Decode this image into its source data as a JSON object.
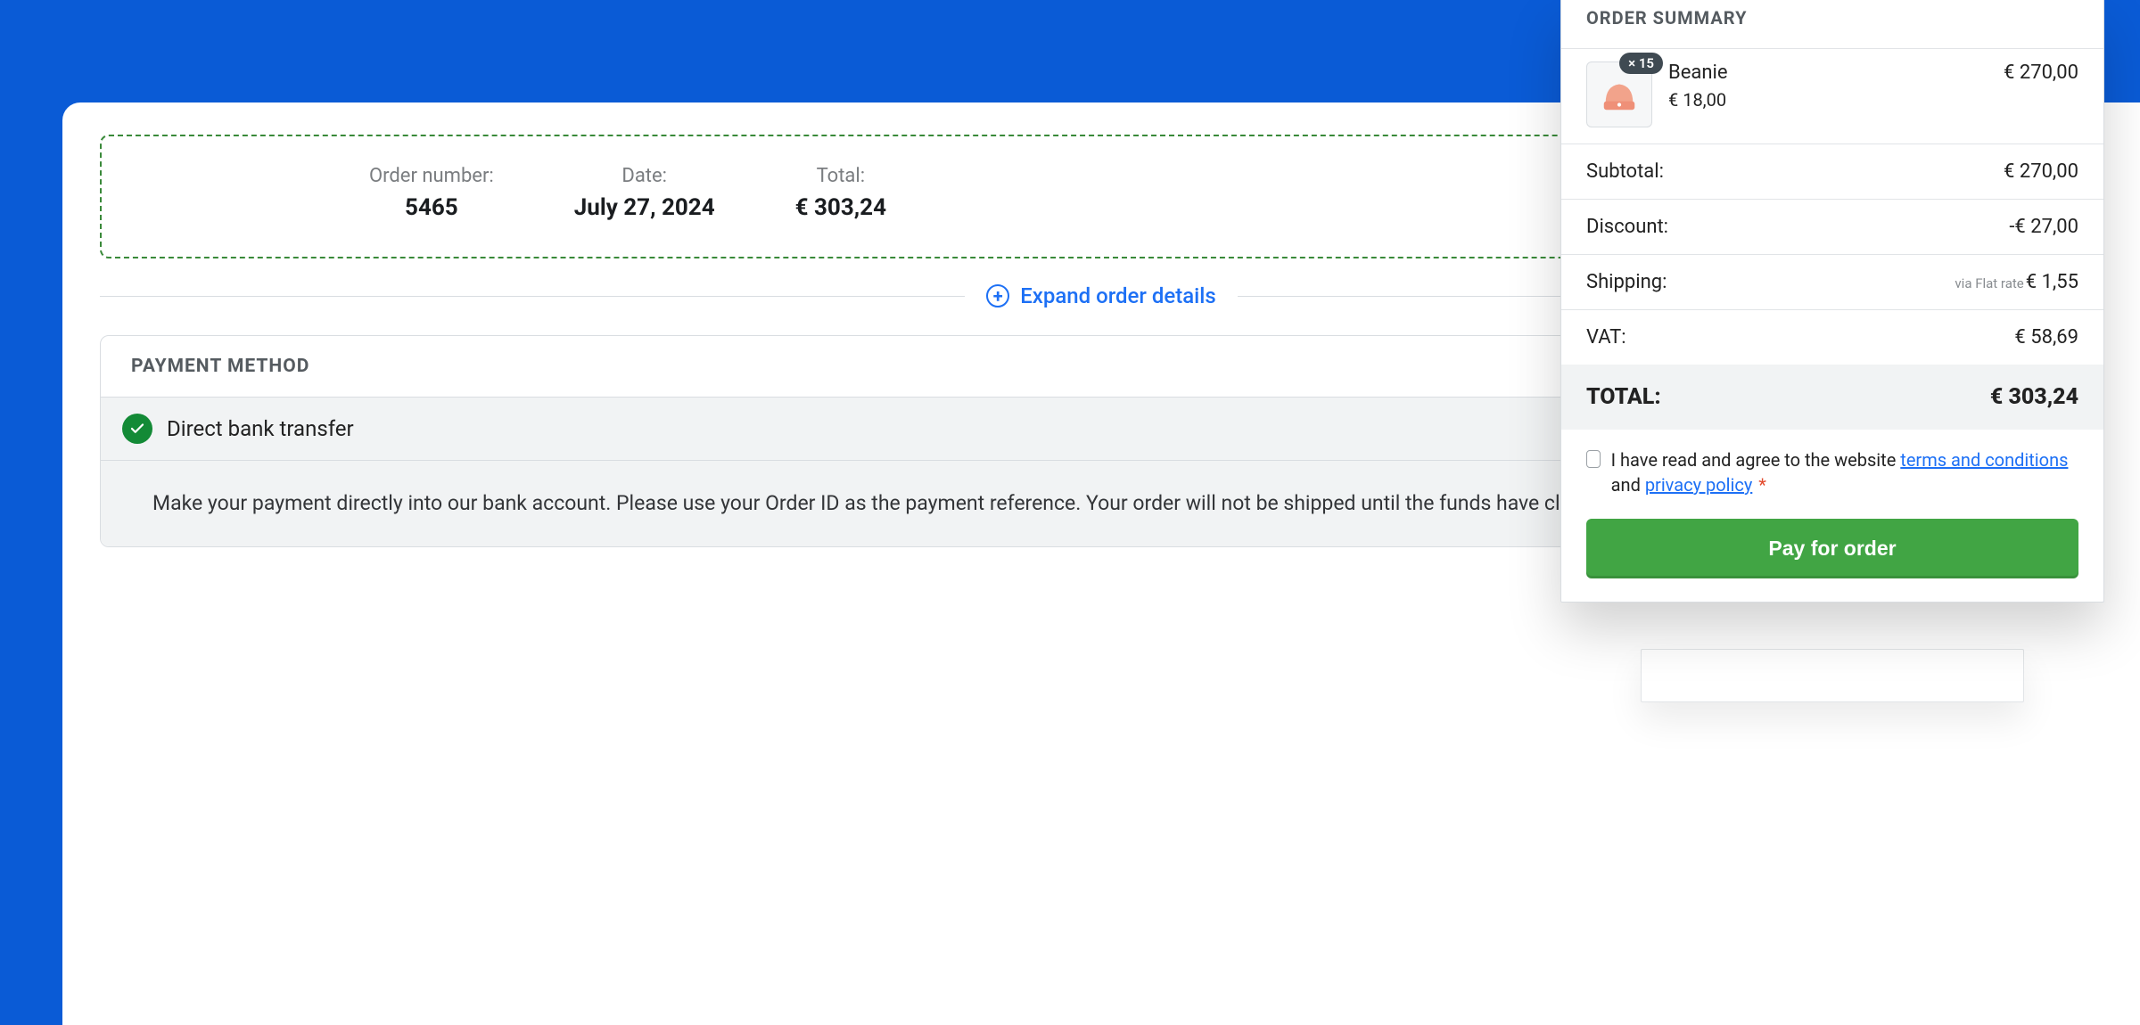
{
  "order_info": {
    "number_label": "Order number:",
    "number_value": "5465",
    "date_label": "Date:",
    "date_value": "July 27, 2024",
    "total_label": "Total:",
    "total_value": "€ 303,24"
  },
  "expand_label": "Expand order details",
  "payment": {
    "section_title": "PAYMENT METHOD",
    "option_title": "Direct bank transfer",
    "option_desc": "Make your payment directly into our bank account. Please use your Order ID as the payment reference. Your order will not be shipped until the funds have cleared in our account."
  },
  "summary": {
    "title": "ORDER SUMMARY",
    "item": {
      "qty_badge": "× 15",
      "name": "Beanie",
      "unit_price": "€ 18,00",
      "line_price": "€ 270,00"
    },
    "rows": {
      "subtotal_label": "Subtotal:",
      "subtotal_value": "€ 270,00",
      "discount_label": "Discount:",
      "discount_value": "-€ 27,00",
      "shipping_label": "Shipping:",
      "shipping_note": "via Flat rate",
      "shipping_value": "€ 1,55",
      "vat_label": "VAT:",
      "vat_value": "€ 58,69",
      "total_label": "TOTAL:",
      "total_value": "€ 303,24"
    },
    "consent": {
      "pre": "I have read and agree to the website ",
      "terms": "terms and conditions",
      "mid": " and ",
      "privacy": "privacy policy",
      "star": "*"
    },
    "pay_button": "Pay for order"
  }
}
